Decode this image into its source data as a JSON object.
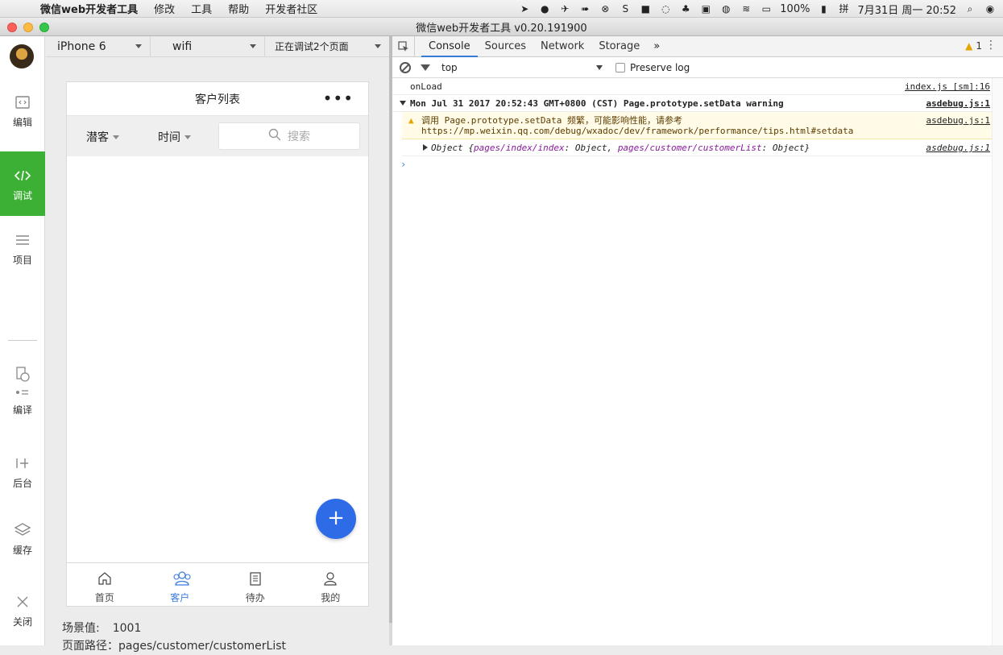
{
  "menubar": {
    "apple": "",
    "app_name": "微信web开发者工具",
    "menus": [
      "修改",
      "工具",
      "帮助",
      "开发者社区"
    ],
    "battery": "100%",
    "clock": "7月31日 周一  20:52"
  },
  "window": {
    "title": "微信web开发者工具 v0.20.191900"
  },
  "sidebar": {
    "items": [
      {
        "label": "编辑",
        "icon": "code-file-icon"
      },
      {
        "label": "调试",
        "icon": "code-brackets-icon"
      },
      {
        "label": "项目",
        "icon": "menu-lines-icon"
      },
      {
        "label": "编译",
        "icon": "compile-icon"
      },
      {
        "label": "后台",
        "icon": "background-icon"
      },
      {
        "label": "缓存",
        "icon": "layers-icon"
      },
      {
        "label": "关闭",
        "icon": "close-icon"
      }
    ],
    "active": "调试"
  },
  "simulator": {
    "device": "iPhone 6",
    "network": "wifi",
    "debug_pages": "正在调试2个页面",
    "info_scene_label": "场景值:",
    "info_scene_value": "1001",
    "info_path": "页面路径：pages/customer/customerList"
  },
  "phone": {
    "nav_title": "客户列表",
    "nav_more": "•••",
    "filters": [
      "潜客",
      "时间"
    ],
    "search_placeholder": "搜索",
    "fab_label": "+",
    "tabs": [
      {
        "label": "首页",
        "icon": "home-icon"
      },
      {
        "label": "客户",
        "icon": "users-icon"
      },
      {
        "label": "待办",
        "icon": "clipboard-icon"
      },
      {
        "label": "我的",
        "icon": "user-icon"
      }
    ],
    "active_tab": "客户"
  },
  "devtools": {
    "tabs": [
      "Console",
      "Sources",
      "Network",
      "Storage"
    ],
    "active_tab": "Console",
    "more": "»",
    "warning_count": "1",
    "context": "top",
    "preserve_log": "Preserve log",
    "preserve_checked": false,
    "console": [
      {
        "type": "log",
        "text": "onLoad",
        "source": "index.js [sm]:16"
      },
      {
        "type": "group",
        "text": "Mon Jul 31 2017 20:52:43 GMT+0800 (CST)  Page.prototype.setData warning",
        "source": "asdebug.js:1"
      },
      {
        "type": "warn",
        "text": "调用 Page.prototype.setData 频繁，可能影响性能，请参考",
        "text2": "https://mp.weixin.qq.com/debug/wxadoc/dev/framework/performance/tips.html#setdata",
        "source": "asdebug.js:1"
      },
      {
        "type": "object",
        "prefix": "Object {",
        "k1": "pages/index/index",
        "v1": ": Object, ",
        "k2": "pages/customer/customerList",
        "v2": ": Object}",
        "source": "asdebug.js:1"
      }
    ],
    "prompt": "›"
  },
  "colors": {
    "active_green": "#3cb034",
    "tab_blue": "#3b7be0",
    "fab_blue": "#2e6be6",
    "warn_bg": "#fffbe6"
  }
}
